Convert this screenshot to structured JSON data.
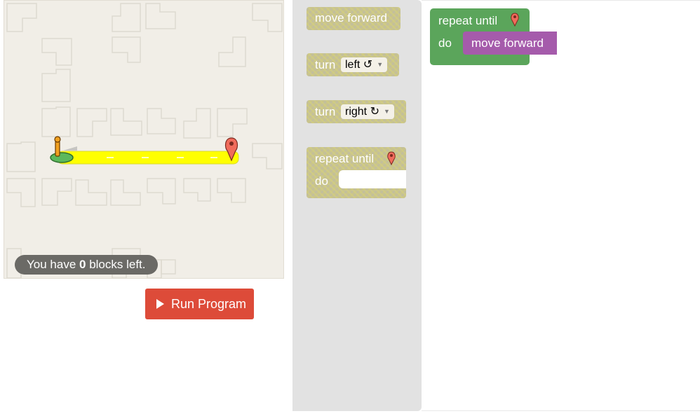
{
  "maze": {
    "status_prefix": "You have ",
    "status_count": "0",
    "status_suffix": " blocks left.",
    "run_label": "Run Program"
  },
  "toolbox": {
    "move_forward": "move forward",
    "turn_left_label": "turn",
    "turn_left_value": "left ↺",
    "turn_right_label": "turn",
    "turn_right_value": "right ↻",
    "repeat_label": "repeat until",
    "do_label": "do"
  },
  "workspace": {
    "repeat_label": "repeat until",
    "do_label": "do",
    "move_forward": "move forward"
  },
  "colors": {
    "run_button": "#dd4b39",
    "repeat_block": "#5ba55b",
    "move_block": "#a55bab",
    "path": "#ffff00",
    "goal_marker": "#f06b5b"
  },
  "icons": [
    "play-icon",
    "start-pegman-icon",
    "goal-marker-icon",
    "dropdown-arrow-icon"
  ]
}
